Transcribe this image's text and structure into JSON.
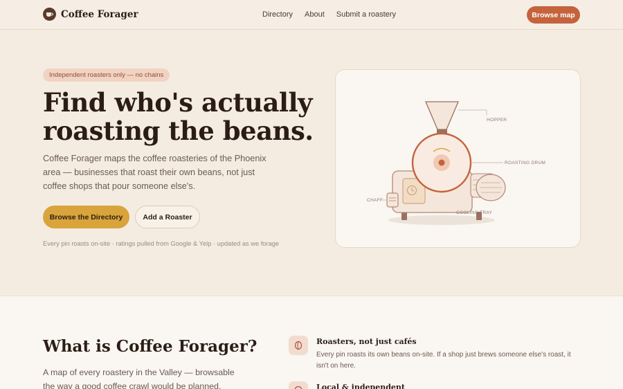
{
  "nav": {
    "brand": "Coffee Forager",
    "links": [
      "Directory",
      "About",
      "Submit a roastery"
    ],
    "cta": "Browse map"
  },
  "hero": {
    "badge": "Independent roasters only — no chains",
    "title_line1": "Find who's actually",
    "title_line2": "roasting the beans.",
    "subtitle": "Coffee Forager maps the coffee roasteries of the Phoenix area — businesses that roast their own beans, not just coffee shops that pour someone else's.",
    "primary_button": "Browse the Directory",
    "secondary_button": "Add a Roaster",
    "note": "Every pin roasts on-site · ratings pulled from Google & Yelp · updated as we forage"
  },
  "illustration": {
    "labels": {
      "hopper": "HOPPER",
      "drum": "ROASTING DRUM",
      "chaff": "CHAFF",
      "cooling": "COOLING TRAY"
    }
  },
  "about": {
    "title": "What is Coffee Forager?",
    "subtitle": "A map of every roastery in the Valley — browsable the way a good coffee crawl would be planned.",
    "features": [
      {
        "icon": "coffee-bean-icon",
        "title": "Roasters, not just cafés",
        "description": "Every pin roasts its own beans on-site. If a shop just brews someone else's roast, it isn't on here."
      },
      {
        "icon": "pin-icon",
        "title": "Local & independent",
        "description": ""
      }
    ]
  },
  "colors": {
    "accent": "#c4633c",
    "gold": "#d9a43b",
    "background": "#f5ece1",
    "ink": "#2b1d16"
  }
}
